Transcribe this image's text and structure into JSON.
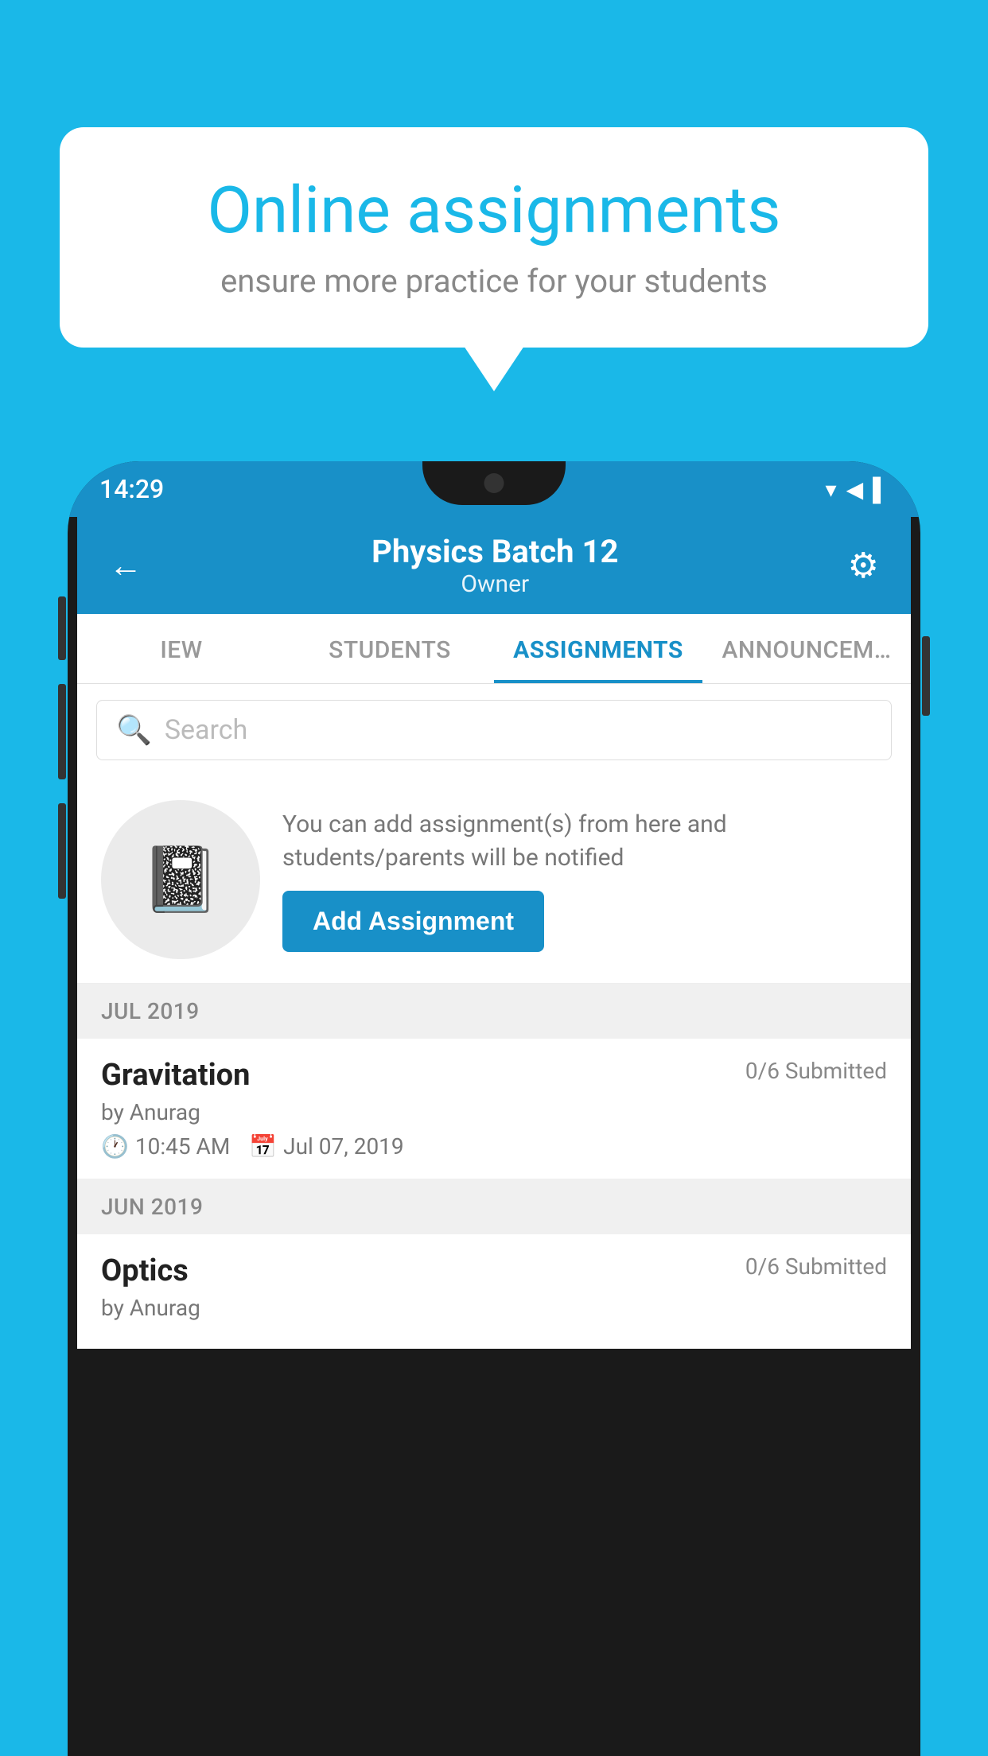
{
  "background": {
    "color": "#1ab8e8"
  },
  "speech_bubble": {
    "title": "Online assignments",
    "subtitle": "ensure more practice for your students"
  },
  "phone": {
    "status_bar": {
      "time": "14:29",
      "icons": "▼◀▌"
    },
    "header": {
      "title": "Physics Batch 12",
      "subtitle": "Owner",
      "back_label": "←",
      "settings_label": "⚙"
    },
    "tabs": [
      {
        "label": "IEW",
        "active": false
      },
      {
        "label": "STUDENTS",
        "active": false
      },
      {
        "label": "ASSIGNMENTS",
        "active": true
      },
      {
        "label": "ANNOUNCEM…",
        "active": false
      }
    ],
    "search": {
      "placeholder": "Search"
    },
    "add_assignment_section": {
      "info_text": "You can add assignment(s) from here and students/parents will be notified",
      "button_label": "Add Assignment"
    },
    "sections": [
      {
        "month": "JUL 2019",
        "assignments": [
          {
            "name": "Gravitation",
            "submitted": "0/6 Submitted",
            "by": "by Anurag",
            "time": "10:45 AM",
            "date": "Jul 07, 2019"
          }
        ]
      },
      {
        "month": "JUN 2019",
        "assignments": [
          {
            "name": "Optics",
            "submitted": "0/6 Submitted",
            "by": "by Anurag",
            "time": "",
            "date": ""
          }
        ]
      }
    ]
  }
}
